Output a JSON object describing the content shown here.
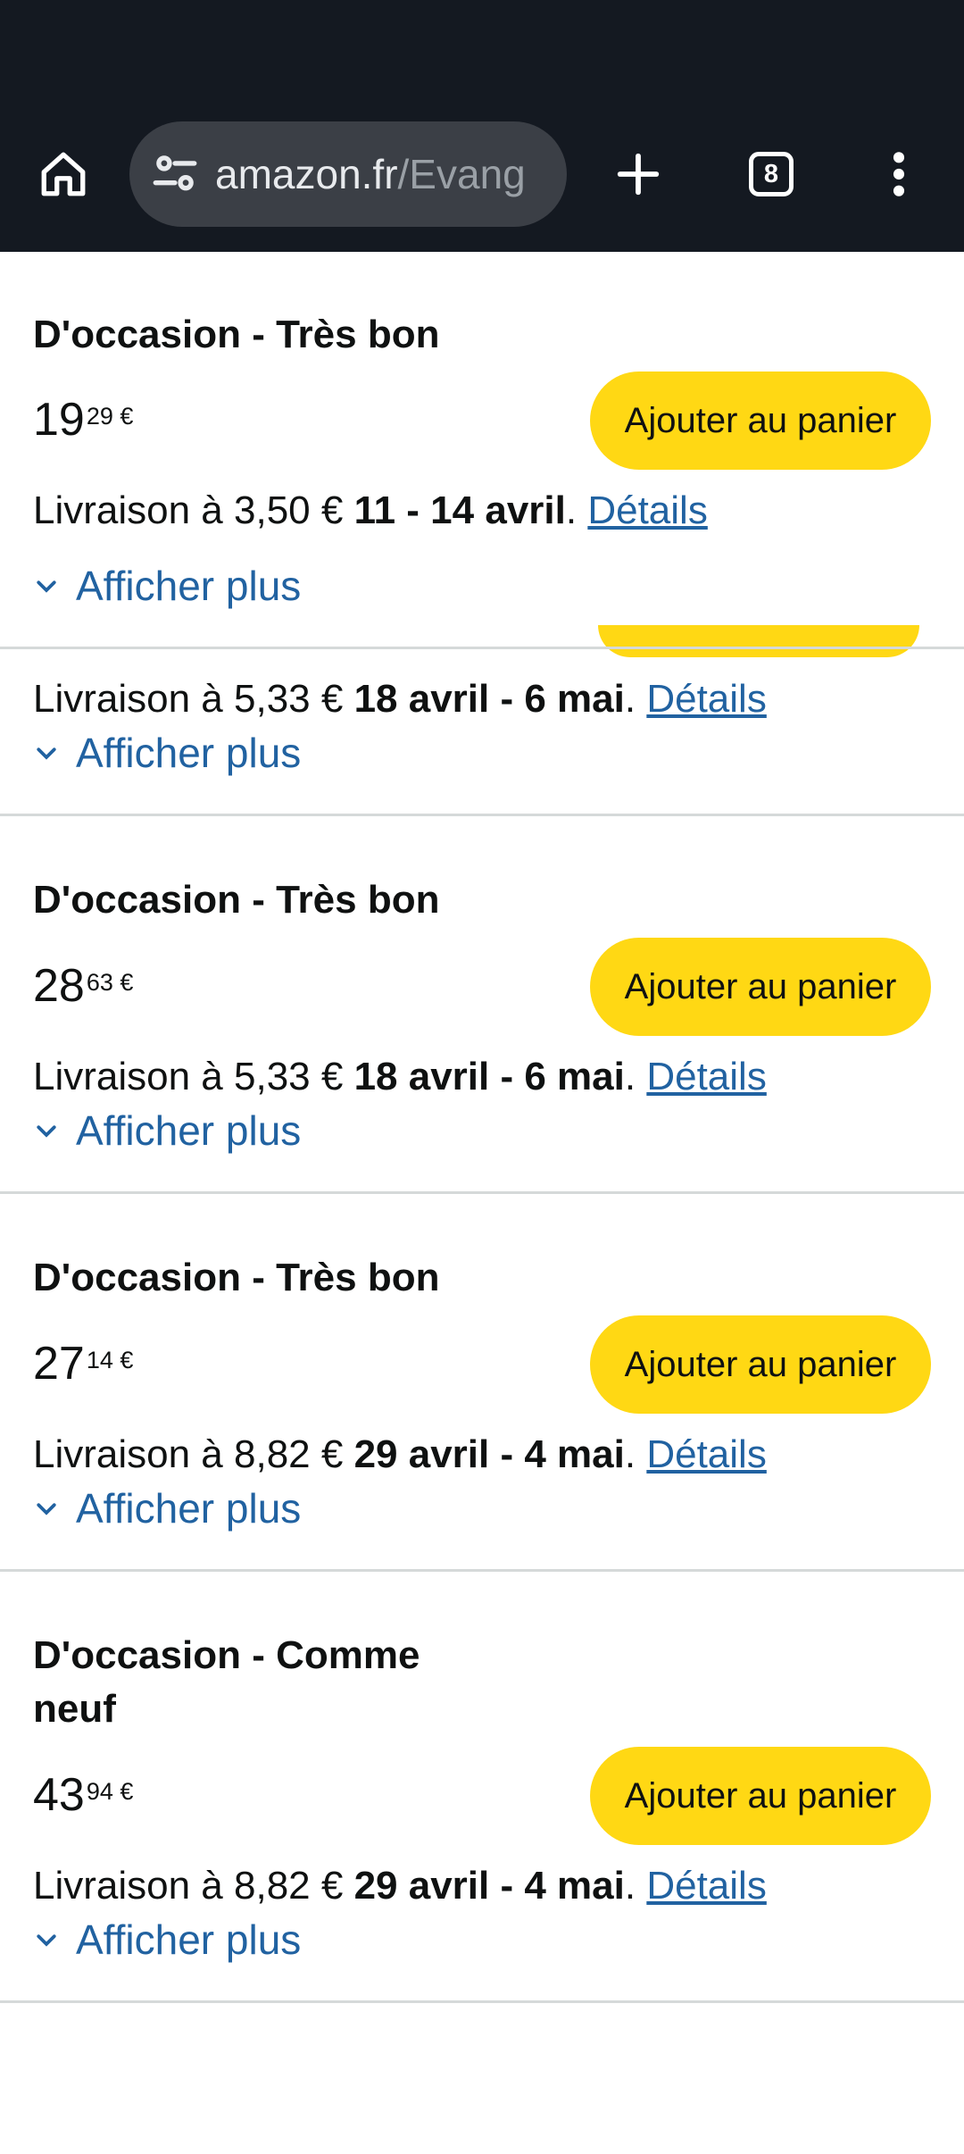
{
  "browser": {
    "url_domain": "amazon.fr",
    "url_path": "/Evang",
    "tab_count": "8"
  },
  "offers": [
    {
      "condition": "D'occasion - Très bon",
      "price_int": "19",
      "price_frac": "29 €",
      "cart_label": "Ajouter au panier",
      "ship_prefix": "Livraison à 3,50 € ",
      "ship_dates": "11 - 14 avril",
      "ship_suffix": ".",
      "details_label": "Détails",
      "more_label": "Afficher plus"
    },
    {
      "condition": "",
      "price_int": "",
      "price_frac": "",
      "cart_label": "",
      "ship_prefix": "Livraison à 5,33 € ",
      "ship_dates": "18 avril - 6 mai",
      "ship_suffix": ".",
      "details_label": "Détails",
      "more_label": "Afficher plus"
    },
    {
      "condition": "D'occasion - Très bon",
      "price_int": "28",
      "price_frac": "63 €",
      "cart_label": "Ajouter au panier",
      "ship_prefix": "Livraison à 5,33 € ",
      "ship_dates": "18 avril - 6 mai",
      "ship_suffix": ".",
      "details_label": "Détails",
      "more_label": "Afficher plus"
    },
    {
      "condition": "D'occasion - Très bon",
      "price_int": "27",
      "price_frac": "14 €",
      "cart_label": "Ajouter au panier",
      "ship_prefix": "Livraison à 8,82 € ",
      "ship_dates": "29 avril - 4 mai",
      "ship_suffix": ".",
      "details_label": "Détails",
      "more_label": "Afficher plus"
    },
    {
      "condition": "D'occasion - Comme neuf",
      "price_int": "43",
      "price_frac": "94 €",
      "cart_label": "Ajouter au panier",
      "ship_prefix": "Livraison à 8,82 € ",
      "ship_dates": "29 avril - 4 mai",
      "ship_suffix": ".",
      "details_label": "Détails",
      "more_label": "Afficher plus"
    }
  ],
  "colors": {
    "topbar": "#141921",
    "cart_button": "#ffd814",
    "link": "#2162a1",
    "divider": "#d5d9d9"
  }
}
